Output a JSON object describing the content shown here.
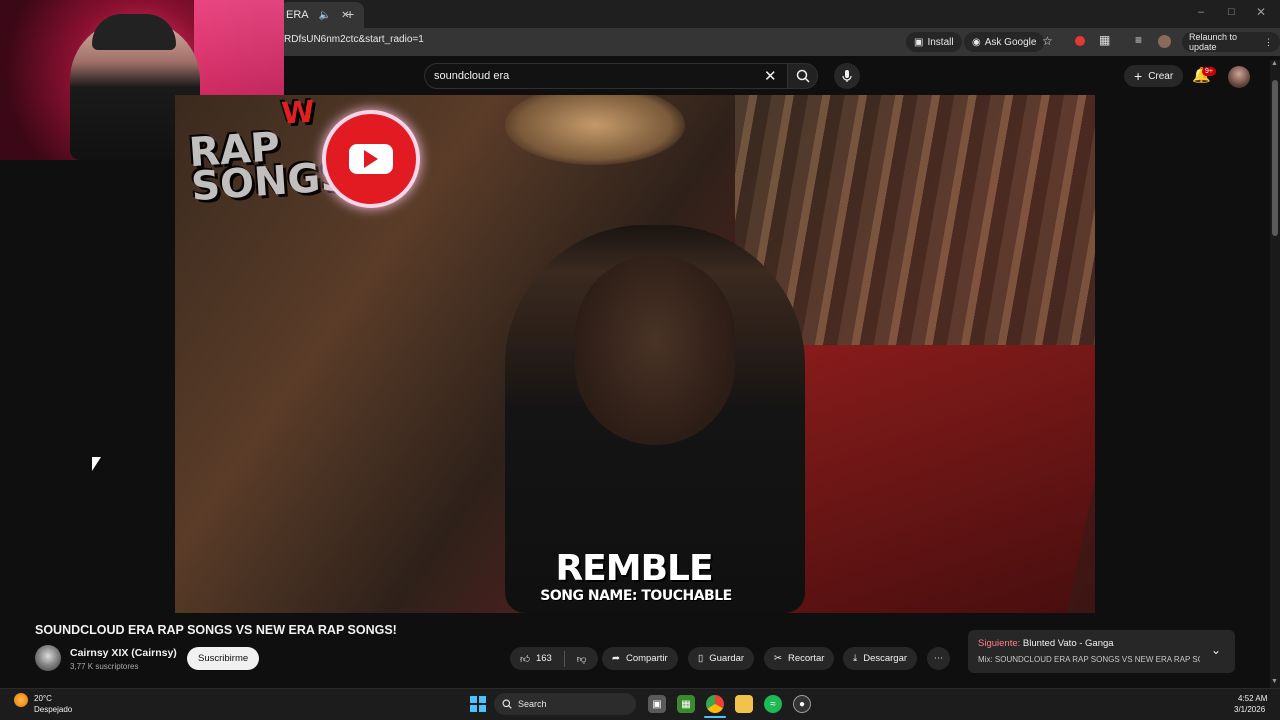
{
  "browser": {
    "tab_title": "ERA",
    "url": "RDfsUN6nm2ctc&start_radio=1",
    "install_label": "Install",
    "ask_google_label": "Ask Google",
    "relaunch_label": "Relaunch to update"
  },
  "youtube": {
    "search_query": "soundcloud era",
    "create_label": "Crear",
    "notification_count": "9+"
  },
  "video": {
    "overlay_logo_text": "RAP SONGS",
    "overlay_logo_prefix": "W",
    "artist": "REMBLE",
    "song_name": "SONG NAME: TOUCHABLE",
    "title": "SOUNDCLOUD ERA RAP SONGS VS NEW ERA RAP SONGS!",
    "channel_name": "Cairnsy XIX (Cairnsy)",
    "subscribers": "3,77 K suscriptores",
    "subscribe_label": "Suscribirme",
    "likes": "163",
    "share_label": "Compartir",
    "save_label": "Guardar",
    "clip_label": "Recortar",
    "download_label": "Descargar"
  },
  "up_next": {
    "prefix": "Siguiente:",
    "title": "Blunted Vato - Ganga",
    "subtitle": "Mix: SOUNDCLOUD ERA RAP SONGS VS NEW ERA RAP SON..."
  },
  "taskbar": {
    "temperature": "20°C",
    "weather": "Despejado",
    "search_label": "Search",
    "time": "4:52 AM",
    "date": "3/1/2026"
  }
}
